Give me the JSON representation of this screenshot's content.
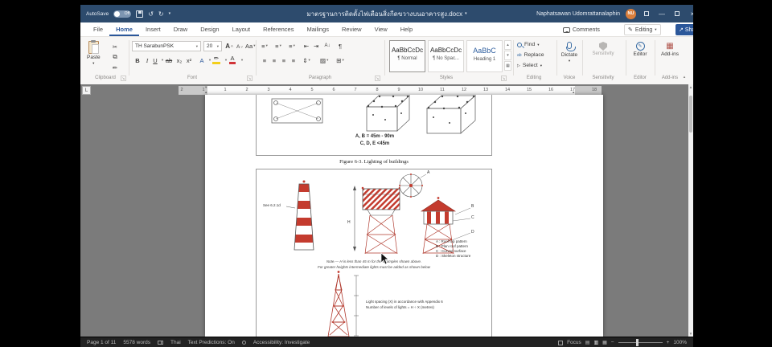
{
  "titlebar": {
    "autosave_label": "AutoSave",
    "autosave_state": "Off",
    "doc_title": "มาตรฐานการติดตั้งไฟเตือนสิ่งกีดขวางบนอาคารสูง.docx",
    "user_name": "Naphatsawan Udomrattanalaphin",
    "user_initials": "NU"
  },
  "tabs": [
    "File",
    "Home",
    "Insert",
    "Draw",
    "Design",
    "Layout",
    "References",
    "Mailings",
    "Review",
    "View",
    "Help"
  ],
  "ribbon_right": {
    "comments": "Comments",
    "editing": "Editing",
    "share": "Share"
  },
  "ribbon": {
    "paste": "Paste",
    "font_name": "TH SarabunPSK",
    "font_size": "20",
    "format": {
      "bold": "B",
      "italic": "I",
      "underline": "U",
      "strike": "ab",
      "subscript": "x₂",
      "superscript": "x²",
      "grow": "A",
      "shrink": "A",
      "change_case": "Aa",
      "effects": "A",
      "font_color": "A"
    },
    "find": "Find",
    "replace": "Replace",
    "select": "Select",
    "dictate": "Dictate",
    "sensitivity": "Sensitivity",
    "editor": "Editor",
    "addins": "Add-ins",
    "styles_cards": [
      {
        "preview": "AaBbCcDc",
        "name": "¶ Normal"
      },
      {
        "preview": "AaBbCcDc",
        "name": "¶ No Spac..."
      },
      {
        "preview": "AaBbC",
        "name": "Heading 1"
      }
    ],
    "labels": {
      "clipboard": "Clipboard",
      "font": "Font",
      "paragraph": "Paragraph",
      "styles": "Styles",
      "editing": "Editing",
      "voice": "Voice",
      "sensitivity": "Sensitivity",
      "editor": "Editor",
      "addins": "Add-ins"
    }
  },
  "icons": {
    "undo": "↺",
    "redo": "↻",
    "chevron": "▾",
    "up": "▴",
    "scissors": "✂",
    "copy": "⧉",
    "format_painter": "✏",
    "list": "≡",
    "outdent": "⇤",
    "indent": "⇥",
    "sort": "A↓",
    "pilcrow": "¶",
    "line_spacing": "⇕",
    "shading": "▨",
    "borders": "⊞",
    "pen": "✎",
    "share": "↗",
    "grid": "▦",
    "launcher": "↘",
    "minimize": "—",
    "close": "×",
    "view_read": "▤",
    "view_print": "▥",
    "view_web": "▦",
    "plus": "+",
    "minus": "−",
    "tab_selector": "L"
  },
  "ruler": {
    "numbers": [
      "2",
      "1",
      "1",
      "2",
      "3",
      "4",
      "5",
      "6",
      "7",
      "8",
      "9",
      "10",
      "11",
      "12",
      "13",
      "14",
      "15",
      "16",
      "17",
      "18"
    ]
  },
  "document": {
    "figure1": {
      "note1": "A, B = 45m - 90m",
      "note2": "C, D, E <45m",
      "caption": "Figure 6-3.    Lighting of buildings"
    },
    "figure2": {
      "see_note": "See 6.2.1d",
      "dim_h": "H",
      "marker_a": "A",
      "marker_b": "B",
      "marker_c": "C",
      "marker_d": "D",
      "legend": [
        "A : Roof top pattern",
        "B : Plan roof pattern",
        "C : Curved surface",
        "D : Skeleton structure"
      ],
      "note1": "Note.— H is less than 45 m for the examples shown above.",
      "note2": "For greater heights intermediate lights must be added as shown below",
      "spacing1": "Light spacing (X) in accordance with Appendix 6",
      "spacing2": "Number of levels of lights = H ÷ X (metres)"
    }
  },
  "statusbar": {
    "page": "Page 1 of 11",
    "words": "5578 words",
    "language": "Thai",
    "predictions": "Text Predictions: On",
    "accessibility": "Accessibility: Investigate",
    "focus": "Focus",
    "zoom": "100%"
  }
}
